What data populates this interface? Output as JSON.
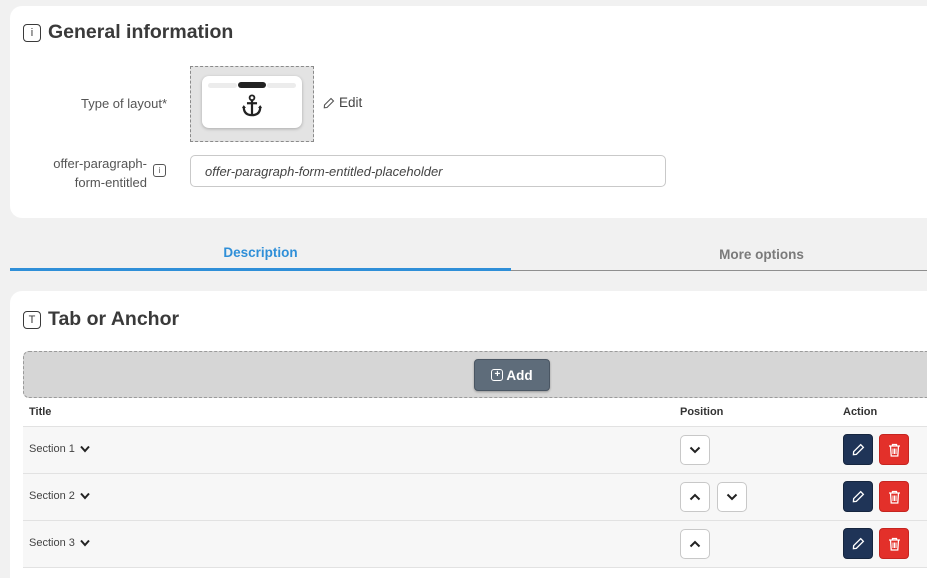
{
  "general": {
    "title": "General information",
    "title_icon": "info-icon",
    "layout_label": "Type of layout*",
    "layout_icon": "anchor-icon",
    "edit_label": "Edit",
    "entitled_label_line1": "offer-paragraph-",
    "entitled_label_line2": "form-entitled",
    "entitled_placeholder": "offer-paragraph-form-entitled-placeholder",
    "entitled_value": ""
  },
  "tabs": [
    {
      "label": "Description",
      "active": true
    },
    {
      "label": "More options",
      "active": false
    }
  ],
  "tab_anchor": {
    "title": "Tab or Anchor",
    "title_icon": "text-box-icon",
    "add_label": "Add",
    "columns": {
      "title": "Title",
      "position": "Position",
      "action": "Action"
    },
    "rows": [
      {
        "title": "Section 1",
        "can_move_up": false,
        "can_move_down": true
      },
      {
        "title": "Section 2",
        "can_move_up": true,
        "can_move_down": true
      },
      {
        "title": "Section 3",
        "can_move_up": true,
        "can_move_down": false
      }
    ]
  },
  "colors": {
    "accent": "#2f8fd8",
    "edit_button": "#1f3457",
    "delete_button": "#e3302a",
    "add_button": "#5e6c7a"
  }
}
